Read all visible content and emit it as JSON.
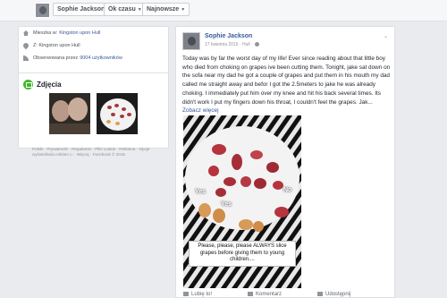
{
  "topbar": {
    "name_button": "Sophie Jackson",
    "time_button": "Ok czasu",
    "sort_button": "Najnowsze"
  },
  "about": {
    "lives_label": "Mieszka w:",
    "lives_value": "Kingston upon Hull",
    "from_value": "Z: Kingston upon Hull",
    "followers_label": "Obserwowana przez",
    "followers_value": "9004 użytkowników"
  },
  "photos": {
    "title": "Zdjęcia"
  },
  "footer": {
    "links": "Polski · Prywatność · Regulamin · Pliki cookie · Reklama · Opcje wyświetlania reklam ▷ · Więcej · Facebook © 2015"
  },
  "post": {
    "author": "Sophie Jackson",
    "date": "17 kwietnia 2015 · Hull ·",
    "body": "Today was by far the worst day of my life! Ever since reading about that little boy who died from choking on grapes ive been cutting them. Tonight, jake sat down on the sofa near my dad he got a couple of grapes and put them in his mouth my dad called me straight away and befor I got the 2.5meters to jake he was already choking. I immediately put him over my knee and hit his back several times. Its didn't work I put my fingers down his throat, I couldn't feel the grapes. Jak... ",
    "see_more": "Zobacz więcej",
    "image": {
      "label_yes_1": "Yes",
      "label_yes_2": "Yes",
      "label_no": "No",
      "caption": "Please, please, please ALWAYS slice grapes before giving them to young children...."
    },
    "actions": {
      "like": "Lubię to!",
      "comment": "Komentarz",
      "share": "Udostępnij"
    }
  },
  "colors": {
    "link": "#365899",
    "page_bg": "#e9ebee",
    "grape": "#b5343e"
  }
}
